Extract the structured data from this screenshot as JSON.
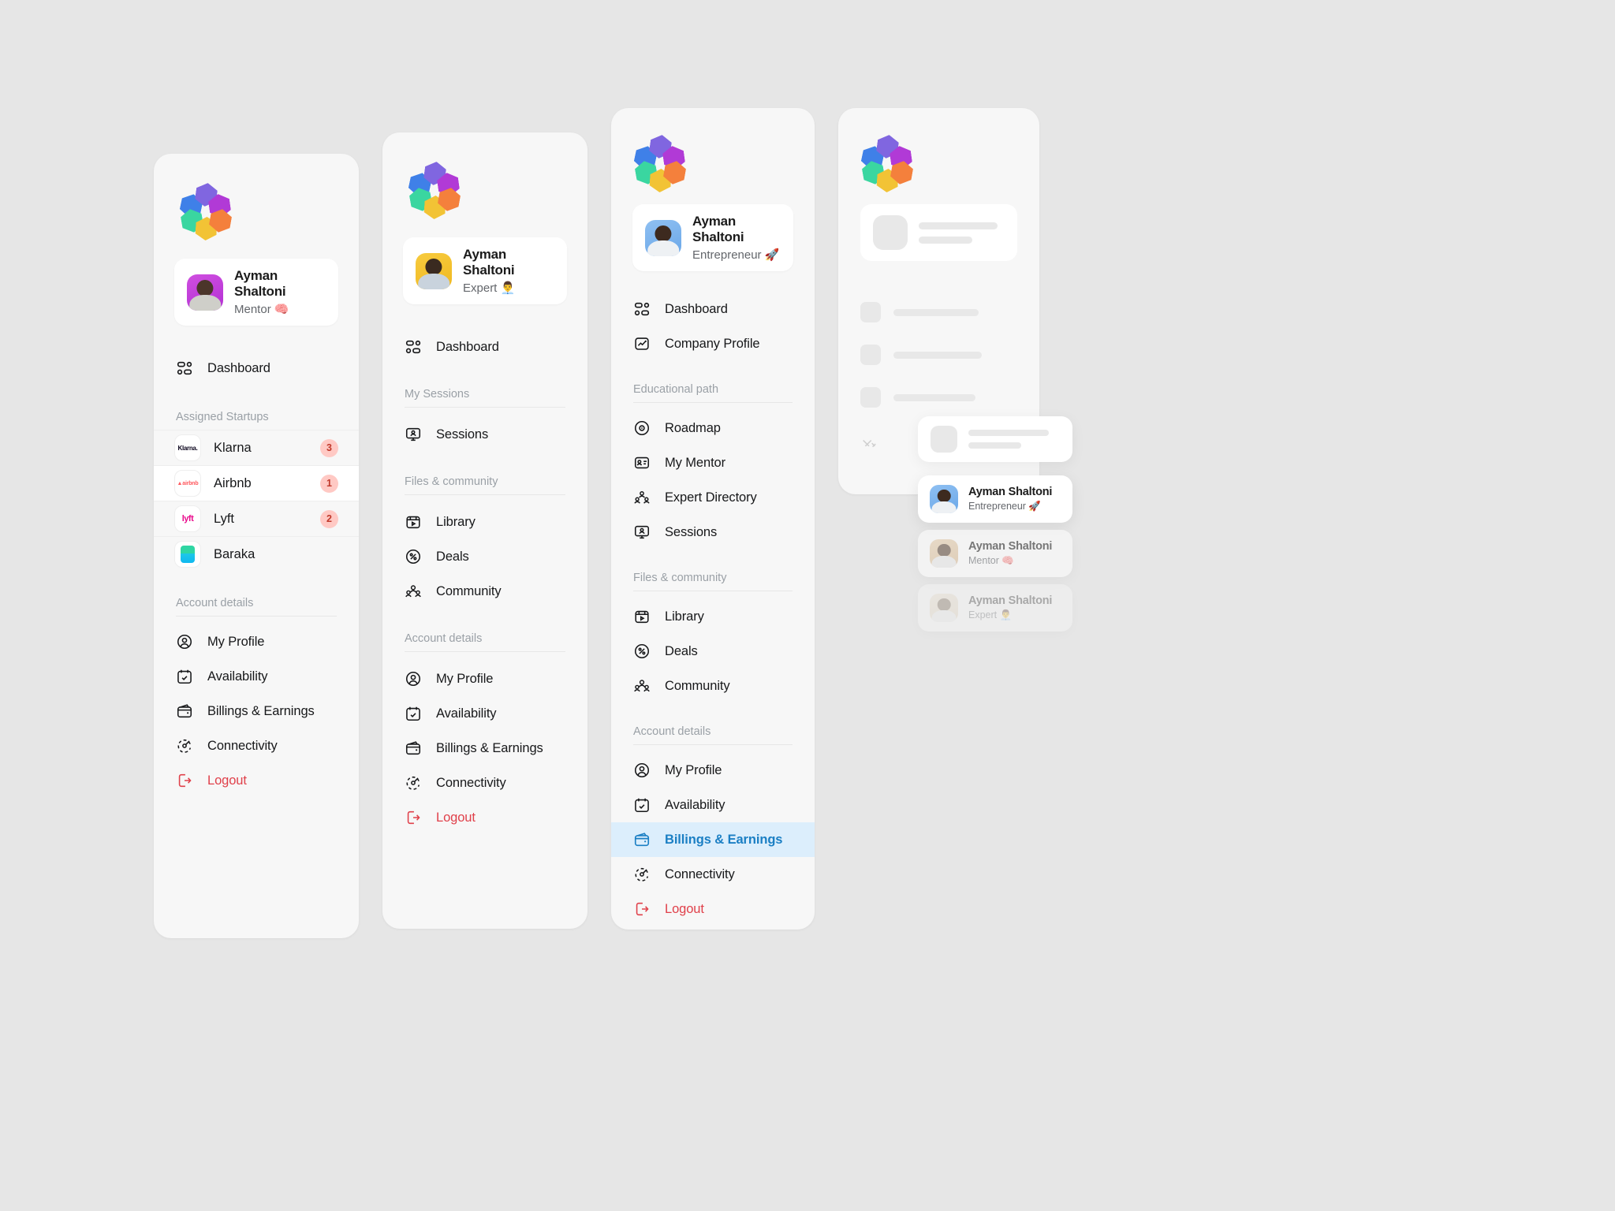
{
  "brand": {
    "logo_name": "hexagon-flower-logo",
    "colors": [
      "#3f80e8",
      "#8066e0",
      "#b13ad6",
      "#3ad6a0",
      "#f2c335",
      "#f4803c"
    ]
  },
  "accent": {
    "active_bg": "#dceefc",
    "active_text": "#1b7fc4",
    "logout": "#e0404a",
    "badge_bg": "#ffc9c4",
    "badge_text": "#c0392b"
  },
  "mentor_sidebar": {
    "profile": {
      "name": "Ayman Shaltoni",
      "role": "Mentor 🧠"
    },
    "dashboard": "Dashboard",
    "startups_label": "Assigned Startups",
    "startups": [
      {
        "name": "Klarna",
        "badge": "3",
        "logo": "klarna-logo",
        "selected": false
      },
      {
        "name": "Airbnb",
        "badge": "1",
        "logo": "airbnb-logo",
        "selected": true
      },
      {
        "name": "Lyft",
        "badge": "2",
        "logo": "lyft-logo",
        "selected": false
      },
      {
        "name": "Baraka",
        "badge": "",
        "logo": "baraka-logo",
        "selected": false
      }
    ],
    "account_label": "Account details",
    "account": [
      {
        "label": "My Profile",
        "icon": "user-circle-icon"
      },
      {
        "label": "Availability",
        "icon": "calendar-check-icon"
      },
      {
        "label": "Billings & Earnings",
        "icon": "wallet-icon"
      },
      {
        "label": "Connectivity",
        "icon": "connectivity-icon"
      },
      {
        "label": "Logout",
        "icon": "logout-icon"
      }
    ]
  },
  "expert_sidebar": {
    "profile": {
      "name": "Ayman Shaltoni",
      "role": "Expert 👨‍💼"
    },
    "dashboard": "Dashboard",
    "sessions_label": "My Sessions",
    "sessions": [
      {
        "label": "Sessions",
        "icon": "monitor-user-icon"
      }
    ],
    "files_label": "Files & community",
    "files": [
      {
        "label": "Library",
        "icon": "library-play-icon"
      },
      {
        "label": "Deals",
        "icon": "deals-tag-icon"
      },
      {
        "label": "Community",
        "icon": "community-icon"
      }
    ],
    "account_label": "Account details",
    "account": [
      {
        "label": "My Profile",
        "icon": "user-circle-icon"
      },
      {
        "label": "Availability",
        "icon": "calendar-check-icon"
      },
      {
        "label": "Billings & Earnings",
        "icon": "wallet-icon"
      },
      {
        "label": "Connectivity",
        "icon": "connectivity-icon"
      },
      {
        "label": "Logout",
        "icon": "logout-icon"
      }
    ]
  },
  "entrepreneur_sidebar": {
    "profile": {
      "name": "Ayman Shaltoni",
      "role": "Entrepreneur 🚀"
    },
    "top": [
      {
        "label": "Dashboard",
        "icon": "dashboard-icon"
      },
      {
        "label": "Company Profile",
        "icon": "company-profile-icon"
      }
    ],
    "edu_label": "Educational path",
    "edu": [
      {
        "label": "Roadmap",
        "icon": "roadmap-icon"
      },
      {
        "label": "My Mentor",
        "icon": "mentor-card-icon"
      },
      {
        "label": "Expert Directory",
        "icon": "experts-icon"
      },
      {
        "label": "Sessions",
        "icon": "monitor-user-icon"
      }
    ],
    "files_label": "Files & community",
    "files": [
      {
        "label": "Library",
        "icon": "library-play-icon"
      },
      {
        "label": "Deals",
        "icon": "deals-tag-icon"
      },
      {
        "label": "Community",
        "icon": "community-icon"
      }
    ],
    "account_label": "Account details",
    "account": [
      {
        "label": "My Profile",
        "icon": "user-circle-icon",
        "active": false
      },
      {
        "label": "Availability",
        "icon": "calendar-check-icon",
        "active": false
      },
      {
        "label": "Billings & Earnings",
        "icon": "wallet-icon",
        "active": true
      },
      {
        "label": "Connectivity",
        "icon": "connectivity-icon",
        "active": false
      },
      {
        "label": "Logout",
        "icon": "logout-icon",
        "active": false
      }
    ]
  },
  "switcher": [
    {
      "name": "Ayman Shaltoni",
      "role": "Entrepreneur 🚀",
      "avatar": "av-blue"
    },
    {
      "name": "Ayman Shaltoni",
      "role": "Mentor 🧠",
      "avatar": "av-tan"
    },
    {
      "name": "Ayman Shaltoni",
      "role": "Expert 👨‍💼",
      "avatar": "av-cream"
    }
  ]
}
